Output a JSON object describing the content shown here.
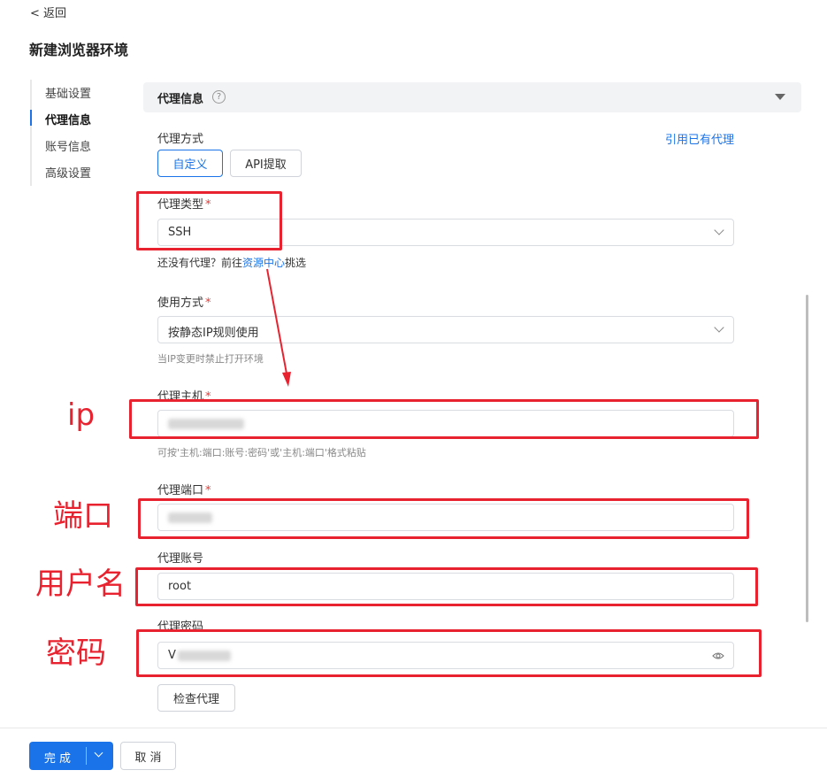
{
  "header": {
    "back_label": "< 返回",
    "title": "新建浏览器环境"
  },
  "side_nav": {
    "items": [
      "基础设置",
      "代理信息",
      "账号信息",
      "高级设置"
    ],
    "active": "代理信息"
  },
  "section": {
    "title": "代理信息",
    "help_glyph": "?"
  },
  "proxy_mode": {
    "label": "代理方式",
    "options": [
      "自定义",
      "API提取"
    ],
    "selected": "自定义",
    "use_existing_link": "引用已有代理"
  },
  "proxy_type": {
    "label": "代理类型",
    "required_mark": "*",
    "value": "SSH",
    "hint_prefix": "还没有代理？前往",
    "hint_link": "资源中心",
    "hint_suffix": "挑选"
  },
  "usage": {
    "label": "使用方式",
    "required_mark": "*",
    "value": "按静态IP规则使用",
    "hint": "当IP变更时禁止打开环境"
  },
  "host": {
    "label": "代理主机",
    "required_mark": "*",
    "hint": "可按'主机:端口:账号:密码'或'主机:端口'格式粘贴"
  },
  "port": {
    "label": "代理端口",
    "required_mark": "*"
  },
  "account": {
    "label": "代理账号",
    "value": "root"
  },
  "password": {
    "label": "代理密码",
    "visible_prefix": "V"
  },
  "check_button": "检查代理",
  "footer": {
    "submit": "完 成",
    "cancel": "取 消"
  },
  "annotations": {
    "ip": "ip",
    "port": "端口",
    "username": "用户名",
    "password": "密码",
    "color": "#e8222e"
  },
  "colors": {
    "accent": "#1a73e8",
    "required": "#e53935"
  }
}
